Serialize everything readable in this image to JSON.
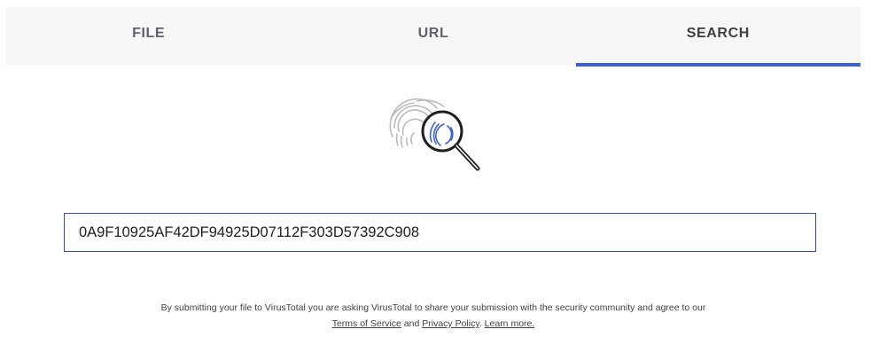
{
  "tabs": [
    {
      "label": "FILE",
      "active": false
    },
    {
      "label": "URL",
      "active": false
    },
    {
      "label": "SEARCH",
      "active": true
    }
  ],
  "icon": "fingerprint-magnifier-icon",
  "accent_color": "#3b61d9",
  "search": {
    "value": "0A9F10925AF42DF94925D07112F303D57392C908",
    "placeholder": ""
  },
  "disclaimer": {
    "text": "By submitting your file to VirusTotal you are asking VirusTotal to share your submission with the security community and agree to our",
    "terms_link": "Terms of Service",
    "and_text": "and",
    "privacy_link": "Privacy Policy",
    "learn_more_link": "Learn more."
  }
}
